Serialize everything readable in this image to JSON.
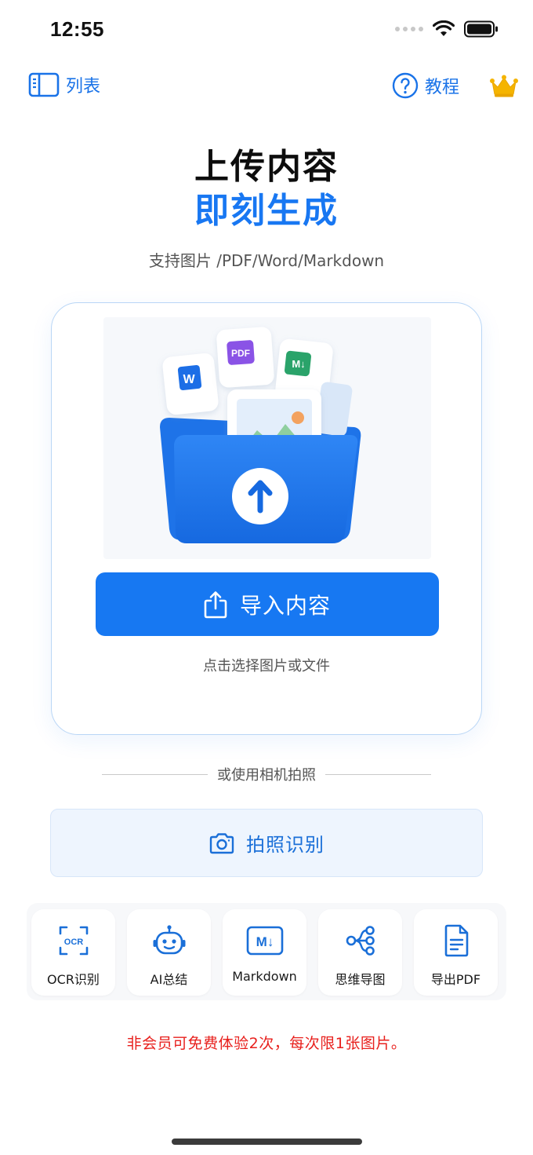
{
  "status_bar": {
    "time": "12:55"
  },
  "nav": {
    "list_label": "列表",
    "tutorial_label": "教程"
  },
  "hero": {
    "title_line1": "上传内容",
    "title_line2": "即刻生成",
    "subtitle": "支持图片 /PDF/Word/Markdown"
  },
  "upload": {
    "file_badges": {
      "word": "W",
      "pdf": "PDF",
      "markdown": "M↓"
    },
    "button_label": "导入内容",
    "hint": "点击选择图片或文件"
  },
  "divider_text": "或使用相机拍照",
  "camera_button_label": "拍照识别",
  "tools": [
    {
      "label": "OCR识别",
      "icon": "ocr-icon",
      "icon_text": "OCR"
    },
    {
      "label": "AI总结",
      "icon": "robot-icon"
    },
    {
      "label": "Markdown",
      "icon": "markdown-icon",
      "icon_text": "M↓"
    },
    {
      "label": "思维导图",
      "icon": "mindmap-icon"
    },
    {
      "label": "导出PDF",
      "icon": "document-icon"
    }
  ],
  "notice": "非会员可免费体验2次，每次限1张图片。",
  "colors": {
    "accent": "#1778f2",
    "notice": "#e8201d",
    "crown": "#f5b400"
  }
}
